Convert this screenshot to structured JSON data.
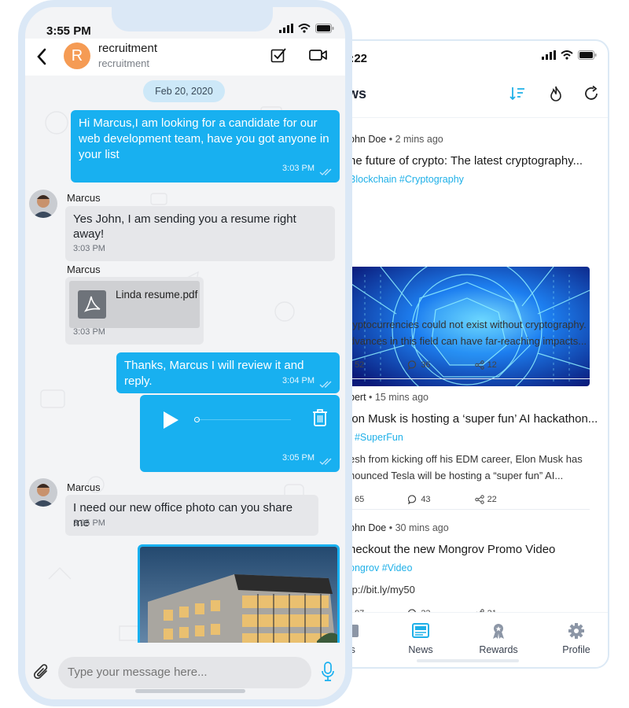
{
  "news": {
    "status_time": "2:22",
    "title": "ws",
    "posts": [
      {
        "author": "ohn Doe",
        "time": "2 mins ago",
        "headline": "he future of crypto: The latest cryptography...",
        "tags": "Blockchain #Cryptography",
        "body1": "ryptocurrencies could not exist without cryptography.",
        "body2": "dvances in this field can have far-reaching impacts...",
        "likes": "52",
        "comments": "36",
        "shares": "12"
      },
      {
        "author": "bert",
        "time": "15 mins ago",
        "headline": "lon Musk is hosting a ‘super fun’ AI hackathon...",
        "tags": "I #SuperFun",
        "body1": "esh from kicking off his EDM career, Elon Musk has",
        "body2": "nounced Tesla will be hosting a “super fun” AI...",
        "likes": "65",
        "comments": "43",
        "shares": "22"
      },
      {
        "author": "ohn Doe",
        "time": "30 mins ago",
        "headline": "heckout the new Mongrov Promo Video",
        "tags": "ongrov #Video",
        "body1": "tp://bit.ly/my50",
        "likes": "97",
        "comments": "33",
        "shares": "31"
      }
    ],
    "tabs": [
      "ts",
      "News",
      "Rewards",
      "Profile"
    ],
    "active_tab": "News",
    "accent": "#1fb0e8"
  },
  "chat": {
    "status_time": "3:55 PM",
    "contact_initial": "R",
    "contact_name": "recruitment",
    "contact_sub": "recruitment",
    "date_chip": "Feb 20, 2020",
    "msg1": {
      "line1": "Hi Marcus,I am looking for a candidate for our",
      "line2": "web development team, have you got anyone in",
      "line3": "your list",
      "time": "3:03 PM"
    },
    "msg2": {
      "sender": "Marcus",
      "line1": "Yes John, I am sending you a resume right",
      "line2": "away!",
      "time": "3:03 PM"
    },
    "msg3": {
      "sender": "Marcus",
      "file": "Linda resume.pdf",
      "time": "3:03 PM"
    },
    "msg4": {
      "text": "Thanks, Marcus I will review it and reply.",
      "time": "3:04 PM"
    },
    "msg5": {
      "time": "3:05 PM",
      "audio_progress": 0
    },
    "msg6": {
      "sender": "Marcus",
      "text": "I need our new office photo can you share me",
      "time": "3:05 PM"
    },
    "composer_placeholder": "Type your message here...",
    "accent": "#18b0f0"
  }
}
